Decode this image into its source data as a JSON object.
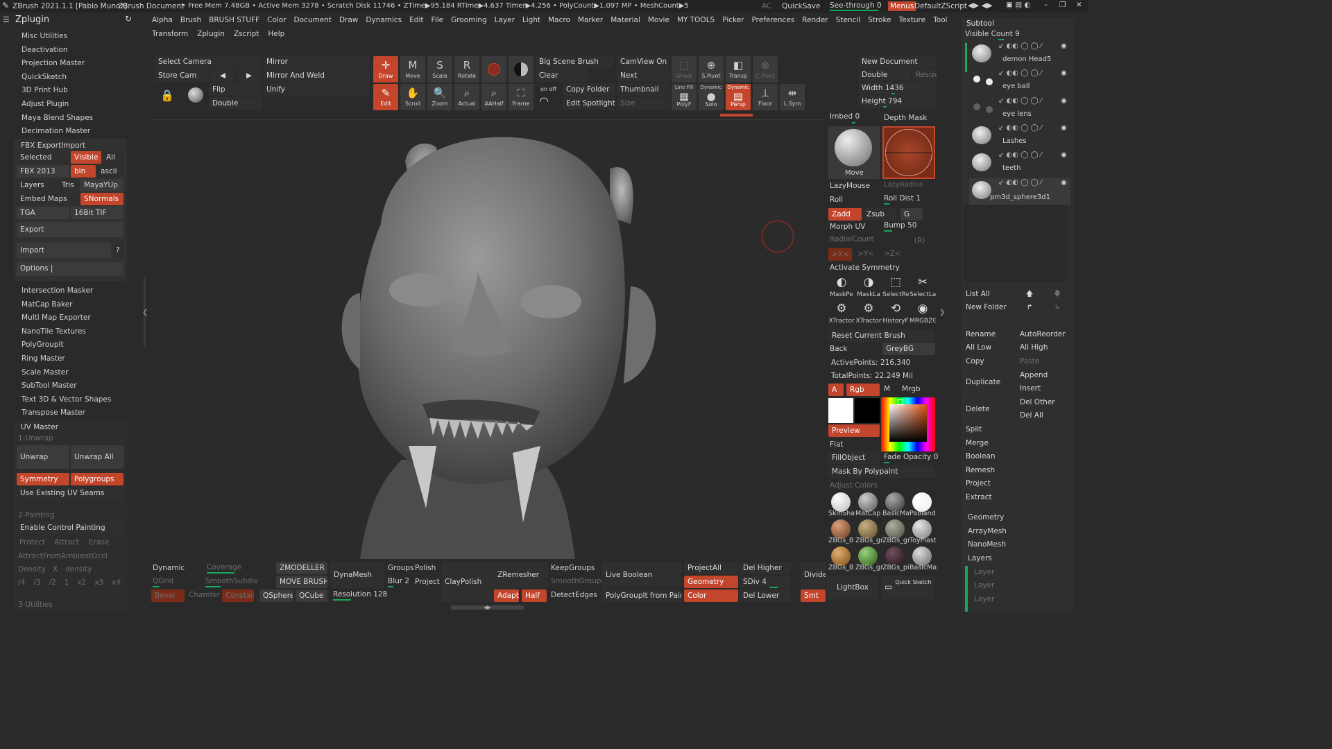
{
  "titlebar": {
    "app": "ZBrush 2021.1.1 [Pablo Munoz]",
    "doc": "ZBrush Document",
    "stats": "• Free Mem 7.48GB • Active Mem 3278 • Scratch Disk 11746 • ZTime▶95.184 RTime▶4.637 Timer▶4.256 • PolyCount▶1.097 MP • MeshCount▶5",
    "ac": "AC",
    "quicksave": "QuickSave",
    "seethrough": "See-through  0",
    "menus": "Menus",
    "script": "DefaultZScript"
  },
  "menubar": {
    "title": "Zplugin",
    "row1": [
      "Alpha",
      "Brush",
      "BRUSH STUFF",
      "Color",
      "Document",
      "Draw",
      "Dynamics",
      "Edit",
      "File",
      "Grooming",
      "Layer",
      "Light",
      "Macro",
      "Marker",
      "Material",
      "Movie",
      "MY TOOLS",
      "Picker",
      "Preferences",
      "Render",
      "Stencil",
      "Stroke",
      "Texture",
      "Tool"
    ],
    "row2": [
      "Transform",
      "Zplugin",
      "Zscript",
      "Help"
    ]
  },
  "leftpanel": {
    "items_top": [
      "Misc Utilities",
      "Deactivation",
      "Projection Master",
      "QuickSketch",
      "3D Print Hub",
      "Adjust Plugin",
      "Maya Blend Shapes",
      "Decimation Master"
    ],
    "fbx": {
      "title": "FBX ExportImport",
      "selected": "Selected",
      "visible": "Visible",
      "all": "All",
      "fbx2013": "FBX 2013",
      "bin": "bin",
      "ascii": "ascii",
      "layers": "Layers",
      "tris": "Tris",
      "mayayup": "MayaYUp",
      "embedmaps": "Embed Maps",
      "snormals": "SNormals",
      "tga": "TGA",
      "tif": "16Bit TIF",
      "export": "Export",
      "import": "Import",
      "q": "?",
      "options": "Options |"
    },
    "items_mid": [
      "Intersection Masker",
      "MatCap Baker",
      "Multi Map Exporter",
      "NanoTile Textures",
      "PolyGroupIt",
      "Ring Master",
      "Scale Master",
      "SubTool Master",
      "Text 3D & Vector Shapes",
      "Transpose Master"
    ],
    "uv": {
      "title": "UV Master",
      "unwrap1": "1-Unwrap",
      "unwrap": "Unwrap",
      "unwrapall": "Unwrap All",
      "symmetry": "Symmetry",
      "polygroups": "Polygroups",
      "existing": "Use Existing UV Seams",
      "painting": "2-Painting",
      "enable": "Enable Control Painting",
      "protect": "Protect",
      "attract": "Attract",
      "erase": "Erase",
      "ambient": "AttractFromAmbientOccl",
      "density": "Density",
      "x": "X",
      "density2": "density",
      "d": [
        "/4",
        "/3",
        "/2",
        "1",
        "x2",
        "x3",
        "x4"
      ],
      "utilities": "3-Utilities"
    }
  },
  "toptools": {
    "selectcamera": "Select Camera",
    "storecam": "Store Cam",
    "mirror": "Mirror",
    "mirrorweld": "Mirror And Weld",
    "flip": "Flip",
    "unify": "Unify",
    "double": "Double",
    "draw": "Draw",
    "move": "Move",
    "scale": "Scale",
    "rotate": "Rotate",
    "edit": "Edit",
    "scroll": "Scroll",
    "zoom": "Zoom",
    "actual": "Actual",
    "aahalf": "AAHalf",
    "frame": "Frame",
    "bigscene": "Big Scene Brush",
    "clear": "Clear",
    "copyfolder": "Copy Folder",
    "editspot": "Edit Spotlight",
    "onoff": "on  off",
    "camview": "CamView On",
    "next": "Next",
    "thumbnail": "Thumbnail",
    "size": "Size",
    "ghost": "Ghost",
    "spivot": "S.Pivot",
    "transp": "Transp",
    "cpivot": "C.Pivot",
    "linefill": "Line Fill",
    "polyf": "PolyF",
    "dynamic": "Dynamic",
    "solo": "Solo",
    "persp_top": "Dynamic",
    "persp": "Persp",
    "floor": "Floor",
    "lsym": "L.Sym"
  },
  "rightdoc": {
    "newdoc": "New Document",
    "double": "Double",
    "resize": "Resize",
    "width": "Width 1436",
    "height": "Height 794"
  },
  "rightpanel": {
    "imbed": "Imbed 0",
    "depthmask": "Depth Mask",
    "movelbl": "Move",
    "lazymouse": "LazyMouse",
    "lazyradius": "LazyRadius",
    "roll": "Roll",
    "rolldist": "Roll Dist 1",
    "zadd": "Zadd",
    "zsub": "Zsub",
    "g": "G",
    "morphuv": "Morph UV",
    "bump": "Bump 50",
    "radialcount": "RadialCount",
    "r": "(R)",
    "x": ">X<",
    "y": ">Y<",
    "z": ">Z<",
    "activate": "Activate Symmetry",
    "tiles": [
      "MaskPe",
      "MaskLa",
      "SelectRe",
      "SelectLa",
      "XTractor",
      "XTractor",
      "HistoryF",
      "MRGBZG"
    ],
    "reset": "Reset Current Brush",
    "back": "Back",
    "greybg": "GreyBG",
    "activepoints": "ActivePoints: 216,340",
    "totalpoints": "TotalPoints: 22.249 Mil",
    "a": "A",
    "rgb": "Rgb",
    "m": "M",
    "mrgb": "Mrgb",
    "preview": "Preview",
    "flat": "Flat",
    "fillobject": "FillObject",
    "fadeopacity": "Fade Opacity 0",
    "maskpoly": "Mask By Polypaint",
    "adjust": "Adjust Colors",
    "mats": [
      "SkinSha",
      "MatCap",
      "BasicMa",
      "Pabland",
      "ZBGs_B",
      "ZBGs_gr",
      "ZBGs_gr",
      "ToyPlast",
      "ZBGs_B",
      "ZBGs_gr",
      "ZBGs_pi",
      "BasicMa"
    ]
  },
  "subtool": {
    "title": "Subtool",
    "visiblecount": "Visible Count 9",
    "items": [
      "demon Head5",
      "eye ball",
      "eye lens",
      "Lashes",
      "teeth",
      "pm3d_sphere3d1"
    ],
    "listall": "List All",
    "newfolder": "New Folder",
    "rename": "Rename",
    "autoreorder": "AutoReorder",
    "alllow": "All Low",
    "allhigh": "All High",
    "copy": "Copy",
    "paste": "Paste",
    "duplicate": "Duplicate",
    "append": "Append",
    "insert": "Insert",
    "delete": "Delete",
    "delother": "Del Other",
    "delall": "Del All",
    "split": "Split",
    "merge": "Merge",
    "boolean": "Boolean",
    "remesh": "Remesh",
    "project": "Project",
    "extract": "Extract",
    "geometry": "Geometry",
    "arraymesh": "ArrayMesh",
    "nanomesh": "NanoMesh",
    "layers": "Layers",
    "layer": "Layer"
  },
  "bottom": {
    "dynamic": "Dynamic",
    "coverage": "Coverage",
    "qgrid": "QGrid",
    "smoothsubdiv": "SmoothSubdiv",
    "bevel": "Bevel",
    "chamfer": "Chamfer",
    "constant": "Constant",
    "zmodeller": "ZMODELLER",
    "movebrush": "MOVE BRUSH",
    "qsphere": "QSphere",
    "qcube": "QCube",
    "dynamesh": "DynaMesh",
    "groups": "Groups",
    "polish": "Polish",
    "blur": "Blur 2",
    "project": "Project",
    "resolution": "Resolution 128",
    "claypolish": "ClayPolish",
    "zremesher": "ZRemesher",
    "adapt": "Adapt",
    "half": "Half",
    "keepgroups": "KeepGroups",
    "smoothgroups": "SmoothGroups",
    "detectedges": "DetectEdges",
    "liveboolean": "Live Boolean",
    "polygroupit": "PolyGroupIt from Paint",
    "projectall": "ProjectAll",
    "geometry": "Geometry",
    "color": "Color",
    "delhigher": "Del Higher",
    "sdiv": "SDiv 4",
    "dellower": "Del Lower",
    "divide": "Divide",
    "smt": "Smt",
    "lightbox": "LightBox",
    "quicksketch": "Quick Sketch"
  },
  "colors": {
    "accent": "#c2452c",
    "slider": "#17a85a",
    "bg": "#2a2a2a"
  }
}
